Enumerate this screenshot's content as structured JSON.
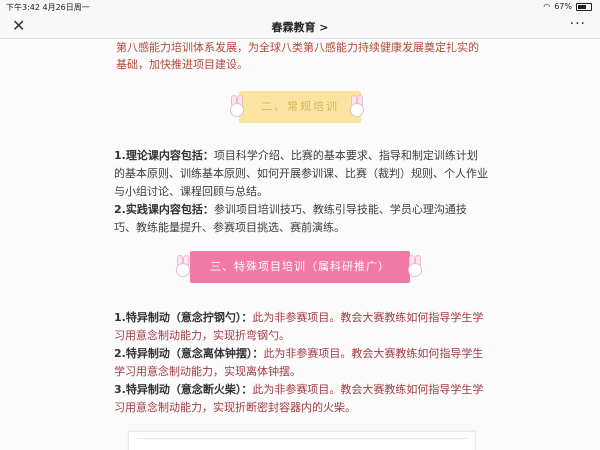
{
  "status_bar": {
    "time_date": "下午3:42  4月26日周一",
    "battery": "67%"
  },
  "nav": {
    "title": "春霖教育 >"
  },
  "article": {
    "top_para": "第八感能力培训体系发展，为全球八类第八感能力持续健康发展奠定扎实的基础，加快推进项目建设。",
    "banner_two": "二、常规培训",
    "theory_label": "1.理论课内容包括：",
    "theory_text": "项目科学介绍、比赛的基本要求、指导和制定训练计划的基本原则、训练基本原则、如何开展参训课、比赛（裁判）规则、个人作业与小组讨论、课程回顾与总结。",
    "practice_label": "2.实践课内容包括：",
    "practice_text": "参训项目培训技巧、教练引导技能、学员心理沟通技巧、教练能量提升、参赛项目挑选、赛前演练。",
    "banner_three": "三、特殊项目培训（属科研推广）",
    "items": [
      {
        "label": "1.特异制动（意念拧钢勺）：",
        "text": "此为非参赛项目。教会大赛教练如何指导学生学习用意念制动能力，实现折弯钢勺。"
      },
      {
        "label": "2.特异制动（意念离体钟摆）：",
        "text": "此为非参赛项目。教会大赛教练如何指导学生学习用意念制动能力，实现离体钟摆。"
      },
      {
        "label": "3.特异制动（意念断火柴）：",
        "text": "此为非参赛项目。教会大赛教练如何指导学生学习用意念制动能力，实现折断密封容器内的火柴。"
      }
    ]
  },
  "icons": {
    "close": "close-icon",
    "more": "more-icon",
    "wifi": "wifi-icon",
    "battery": "battery-icon"
  },
  "colors": {
    "banner_yellow": "#fbe3a0",
    "banner_pink": "#f279a6",
    "highlight_red": "#a33b44"
  }
}
